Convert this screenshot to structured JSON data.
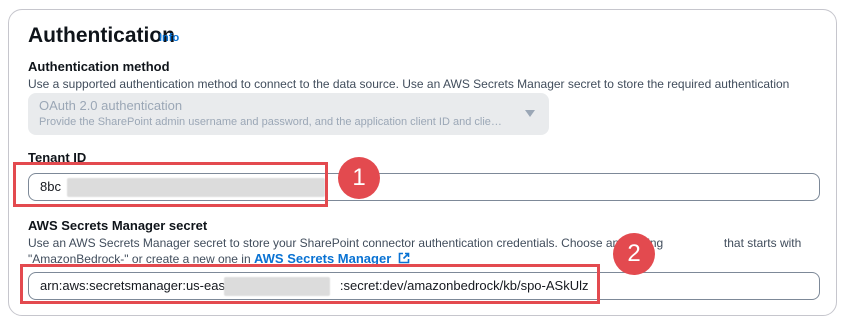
{
  "section": {
    "title": "Authentication",
    "info_label": "Info"
  },
  "auth_method": {
    "label": "Authentication method",
    "description": "Use a supported authentication method to connect to the data source. Use an AWS Secrets Manager secret to store the required authentication credentials.",
    "selected": "OAuth 2.0 authentication",
    "selected_description": "Provide the SharePoint admin username and password, and the application client ID and clie…",
    "disabled": true
  },
  "tenant": {
    "label": "Tenant ID",
    "value_prefix": "8bc"
  },
  "secret": {
    "label": "AWS Secrets Manager secret",
    "description_line1": "Use an AWS Secrets Manager secret to store your SharePoint connector authentication credentials. Choose an existing",
    "description_line1_tail": "that starts with",
    "description_line2": "\"AmazonBedrock-\" or create a new one in",
    "link_label": "AWS Secrets Manager",
    "value_part1": "arn:aws:secretsmanager:us-east-",
    "value_part2": ":secret:dev/amazonbedrock/kb/spo-ASkUlz"
  },
  "callouts": [
    "1",
    "2"
  ],
  "colors": {
    "callout": "#e34a4f",
    "link": "#0972d3"
  }
}
